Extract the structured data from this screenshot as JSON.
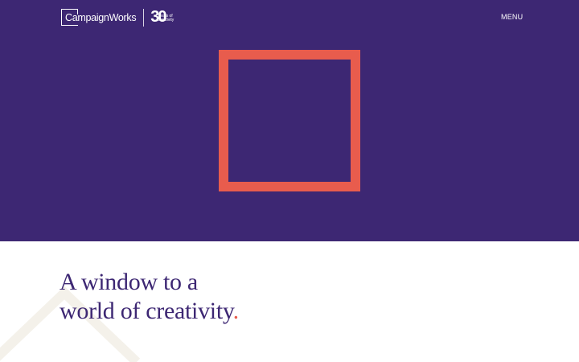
{
  "header": {
    "brand": "CampaignWorks",
    "anniversary_number": "30",
    "anniversary_text": "Years of creativity",
    "menu_label": "MENU"
  },
  "hero": {
    "square_color": "#e85c4d",
    "background_color": "#3d2773"
  },
  "main": {
    "headline_line1": "A window to a",
    "headline_line2": "world of creativity",
    "headline_punct": "."
  }
}
